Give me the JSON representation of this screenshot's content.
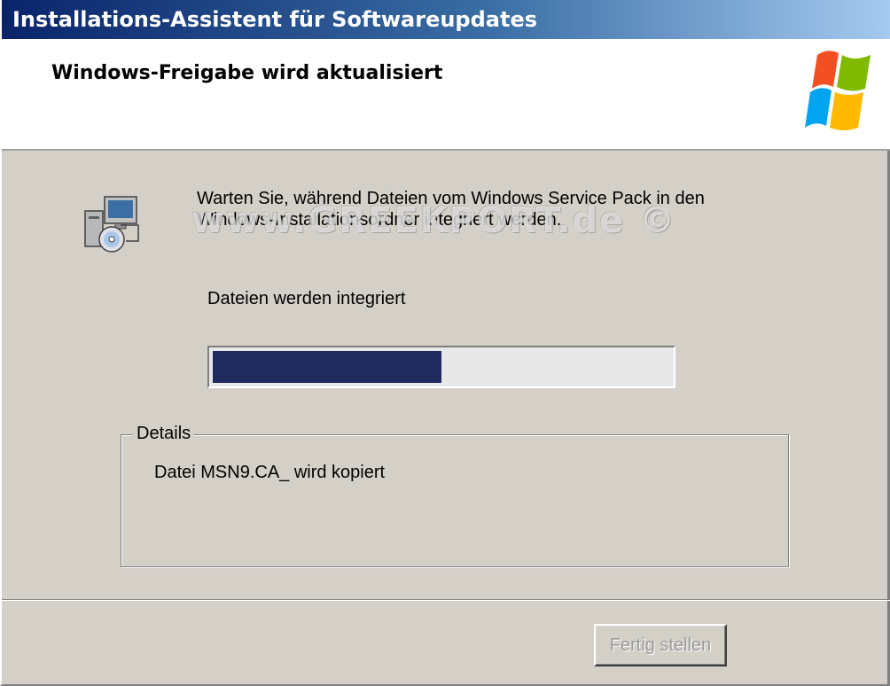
{
  "window": {
    "title": "Installations-Assistent für Softwareupdates"
  },
  "header": {
    "title": "Windows-Freigabe wird aktualisiert",
    "logo_icon": "windows-flag-icon"
  },
  "main": {
    "icon": "computer-cd-setup-icon",
    "info_text": "Warten Sie, während Dateien vom Windows Service Pack in den Windows-Installationsordner integriert werden.",
    "watermark": "www.GREEKPORT.de ©",
    "status_label": "Dateien werden integriert",
    "progress_fraction": 0.5
  },
  "details": {
    "legend": "Details",
    "text": "Datei MSN9.CA_ wird kopiert"
  },
  "footer": {
    "finish_label": "Fertig stellen",
    "finish_enabled": false
  },
  "colors": {
    "title_gradient_start": "#0a246a",
    "title_gradient_end": "#a6caf0",
    "dialog_bg": "#d4d0c8",
    "progress_fill": "#1f2a5e"
  }
}
